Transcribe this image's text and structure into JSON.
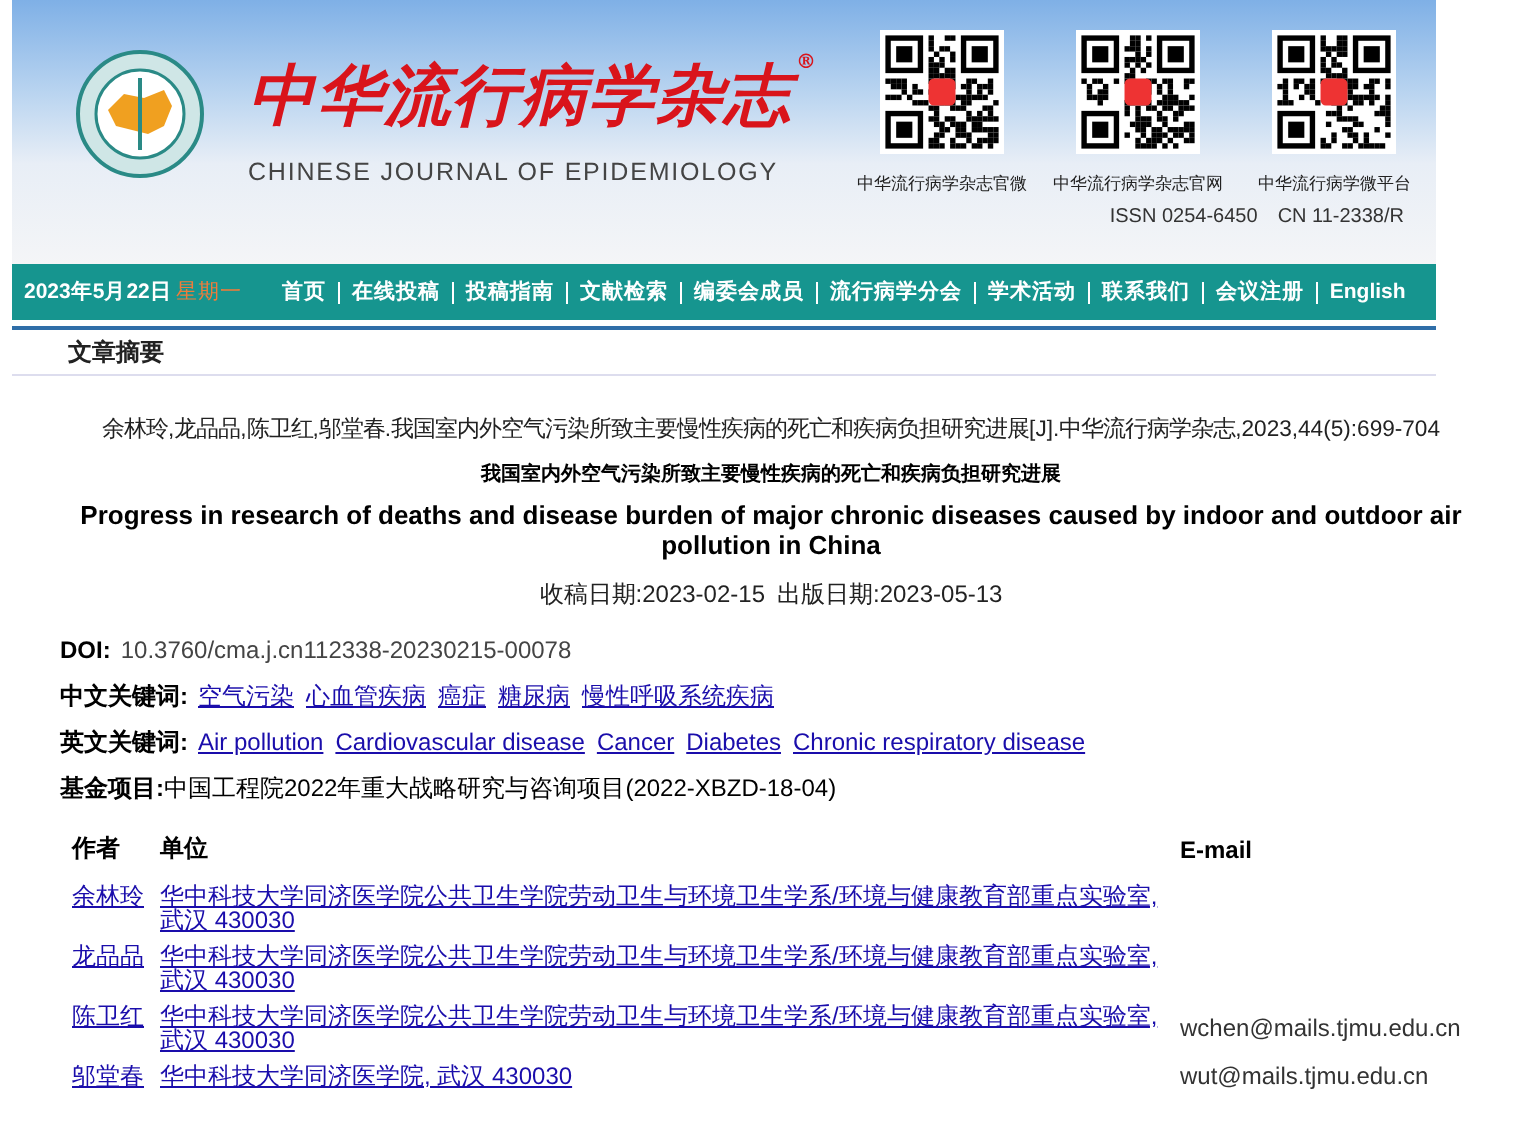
{
  "banner": {
    "title_cn": "中华流行病学杂志",
    "registered": "®",
    "title_en": "CHINESE JOURNAL OF EPIDEMIOLOGY",
    "qr_codes": [
      {
        "caption": "中华流行病学杂志官微"
      },
      {
        "caption": "中华流行病学杂志官网"
      },
      {
        "caption": "中华流行病学微平台"
      }
    ],
    "issn": "ISSN 0254-6450",
    "cn": "CN 11-2338/R"
  },
  "nav": {
    "date": "2023年5月22日",
    "weekday": "星期一",
    "items": [
      "首页",
      "在线投稿",
      "投稿指南",
      "文献检索",
      "编委会成员",
      "流行病学分会",
      "学术活动",
      "联系我们",
      "会议注册",
      "English"
    ]
  },
  "section_title": "文章摘要",
  "citation": "余林玲,龙品品,陈卫红,邬堂春.我国室内外空气污染所致主要慢性疾病的死亡和疾病负担研究进展[J].中华流行病学杂志,2023,44(5):699-704",
  "title_cn": "我国室内外空气污染所致主要慢性疾病的死亡和疾病负担研究进展",
  "title_en": "Progress in research of deaths and disease burden of major chronic diseases caused by indoor and outdoor air pollution in China",
  "dates": [
    "收稿日期:2023-02-15",
    "出版日期:2023-05-13"
  ],
  "doi": {
    "label": "DOI:",
    "value": "10.3760/cma.j.cn112338-20230215-00078"
  },
  "keywords_cn": {
    "label": "中文关键词:",
    "items": [
      "空气污染",
      "心血管疾病",
      "癌症",
      "糖尿病",
      "慢性呼吸系统疾病"
    ]
  },
  "keywords_en": {
    "label": "英文关键词:",
    "items": [
      "Air pollution",
      "Cardiovascular disease",
      "Cancer",
      "Diabetes",
      "Chronic respiratory disease"
    ]
  },
  "fund": {
    "label": "基金项目:",
    "value": "中国工程院2022年重大战略研究与咨询项目(2022-XBZD-18-04)"
  },
  "authors": {
    "columns": [
      "作者",
      "单位",
      "E-mail"
    ],
    "rows": [
      {
        "name": "余林玲",
        "affiliation": "华中科技大学同济医学院公共卫生学院劳动卫生与环境卫生学系/环境与健康教育部重点实验室, 武汉 430030"
      },
      {
        "name": "龙品品",
        "affiliation": "华中科技大学同济医学院公共卫生学院劳动卫生与环境卫生学系/环境与健康教育部重点实验室, 武汉 430030"
      },
      {
        "name": "陈卫红",
        "affiliation": "华中科技大学同济医学院公共卫生学院劳动卫生与环境卫生学系/环境与健康教育部重点实验室, 武汉 430030",
        "email": "wchen@mails.tjmu.edu.cn"
      },
      {
        "name": "邬堂春",
        "affiliation": "华中科技大学同济医学院, 武汉 430030",
        "email": "wut@mails.tjmu.edu.cn"
      }
    ]
  }
}
